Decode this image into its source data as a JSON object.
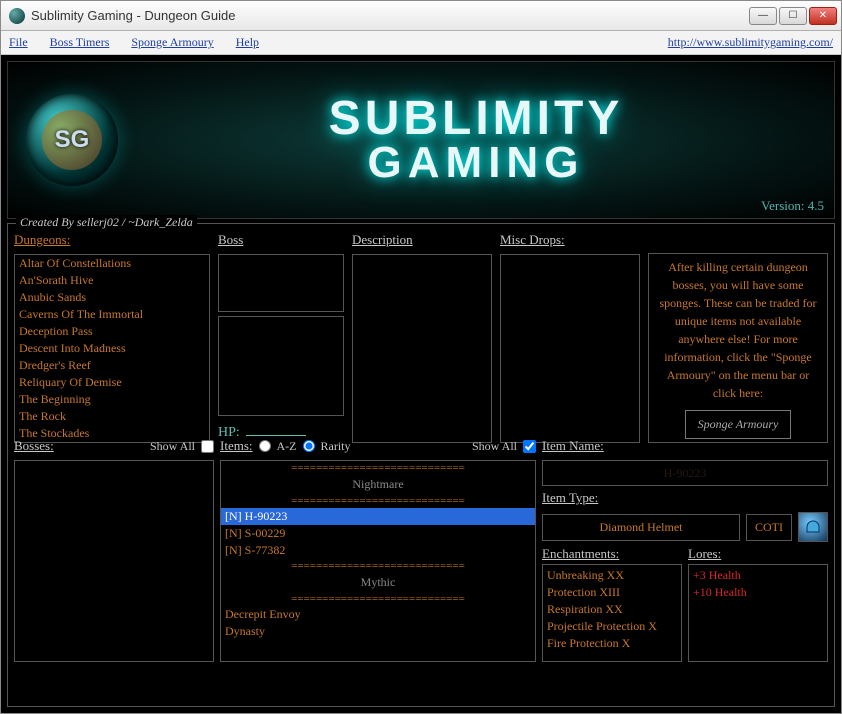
{
  "window": {
    "title": "Sublimity Gaming - Dungeon Guide"
  },
  "menubar": {
    "file": "File",
    "boss_timers": "Boss Timers",
    "sponge_armoury": "Sponge Armoury",
    "help": "Help",
    "site_link": "http://www.sublimitygaming.com/"
  },
  "banner": {
    "logo_text": "SG",
    "line1": "SUBLIMITY",
    "line2": "GAMING",
    "version": "Version: 4.5"
  },
  "credits": "Created By sellerj02 / ~Dark_Zelda",
  "labels": {
    "dungeons": "Dungeons:",
    "boss": "Boss",
    "description": "Description",
    "misc_drops": "Misc Drops:",
    "hp": "HP:",
    "bosses": "Bosses:",
    "show_all": "Show All",
    "items": "Items:",
    "sort_az": "A-Z",
    "sort_rarity": "Rarity",
    "item_name": "Item Name:",
    "item_type": "Item Type:",
    "coti": "COTI",
    "enchantments": "Enchantments:",
    "lores": "Lores:"
  },
  "dungeons": [
    "Altar Of Constellations",
    "An'Sorath Hive",
    "Anubic Sands",
    "Caverns Of The Immortal",
    "Deception Pass",
    "Descent Into Madness",
    "Dredger's Reef",
    "Reliquary Of Demise",
    "The Beginning",
    "The Rock",
    "The Stockades"
  ],
  "info_panel": {
    "text": "After killing certain dungeon bosses, you will have some sponges. These can be traded for unique items not available anywhere else! For more information, click the \"Sponge Armoury\" on the menu bar or click here:",
    "button": "Sponge Armoury"
  },
  "items_list": {
    "divider": "============================",
    "header1": "Nightmare",
    "entries1": [
      "[N] H-90223",
      "[N] S-00229",
      "[N] S-77382"
    ],
    "header2": "Mythic",
    "entries2": [
      "Decrepit Envoy",
      "Dynasty"
    ],
    "selected": "[N] H-90223"
  },
  "item_detail": {
    "name_dark": "H-90223",
    "type_value": "Diamond Helmet",
    "enchantments": [
      "Unbreaking XX",
      "Protection XIII",
      "Respiration XX",
      "Projectile Protection X",
      "Fire Protection X"
    ],
    "lores": [
      "+3 Health",
      "+10 Health"
    ]
  },
  "controls": {
    "bosses_show_all_checked": false,
    "items_show_all_checked": true,
    "sort_mode": "rarity"
  }
}
